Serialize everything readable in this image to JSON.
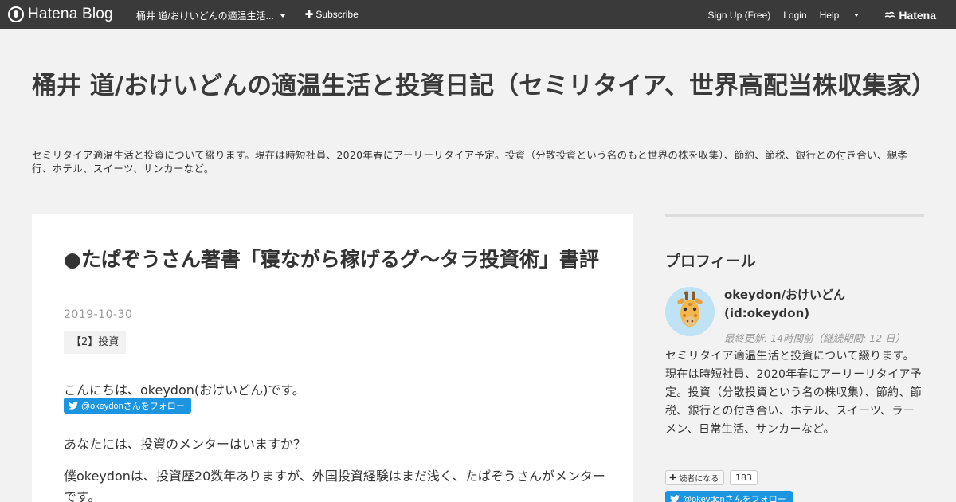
{
  "topbar": {
    "logo_text": "Hatena Blog",
    "blog_title": "桶井 道/おけいどんの適温生活...",
    "subscribe": "Subscribe",
    "signup": "Sign Up (Free)",
    "login": "Login",
    "help": "Help",
    "hatena": "Hatena"
  },
  "header": {
    "title": "桶井 道/おけいどんの適温生活と投資日記（セミリタイア、世界高配当株収集家）",
    "description": "セミリタイア適温生活と投資について綴ります。現在は時短社員、2020年春にアーリーリタイア予定。投資（分散投資という名のもと世界の株を収集）、節約、節税、銀行との付き合い、親孝行、ホテル、スイーツ、サンカーなど。"
  },
  "entry": {
    "title": "●たぱぞうさん著書「寝ながら稼げるグ〜タラ投資術」書評",
    "date": "2019-10-30",
    "category": "【2】投資",
    "paragraph1": "こんにちは、okeydon(おけいどん)です。",
    "follow_label": "@okeydonさんをフォロー",
    "paragraph2": "あなたには、投資のメンターはいますか？",
    "paragraph3": "僕okeydonは、投資歴20数年ありますが、外国投資経験はまだ浅く、たぱぞうさんがメンターです。"
  },
  "sidebar": {
    "heading": "プロフィール",
    "name": "okeydon/おけいどん",
    "id": "(id:okeydon)",
    "updated": "最終更新: 14時間前（継続期間: 12 日）",
    "description": "セミリタイア適温生活と投資について綴ります。現在は時短社員、2020年春にアーリーリタイア予定。投資（分散投資という名の株収集）、節約、節税、銀行との付き合い、ホテル、スイーツ、ラーメン、日常生活、サンカーなど。",
    "reader_label": "読者になる",
    "reader_count": "183",
    "follow_label": "@okeydonさんをフォロー"
  },
  "colors": {
    "topbar_bg": "#3a3a3a",
    "page_bg": "#f2f2f2",
    "twitter_blue": "#1b95e0"
  }
}
